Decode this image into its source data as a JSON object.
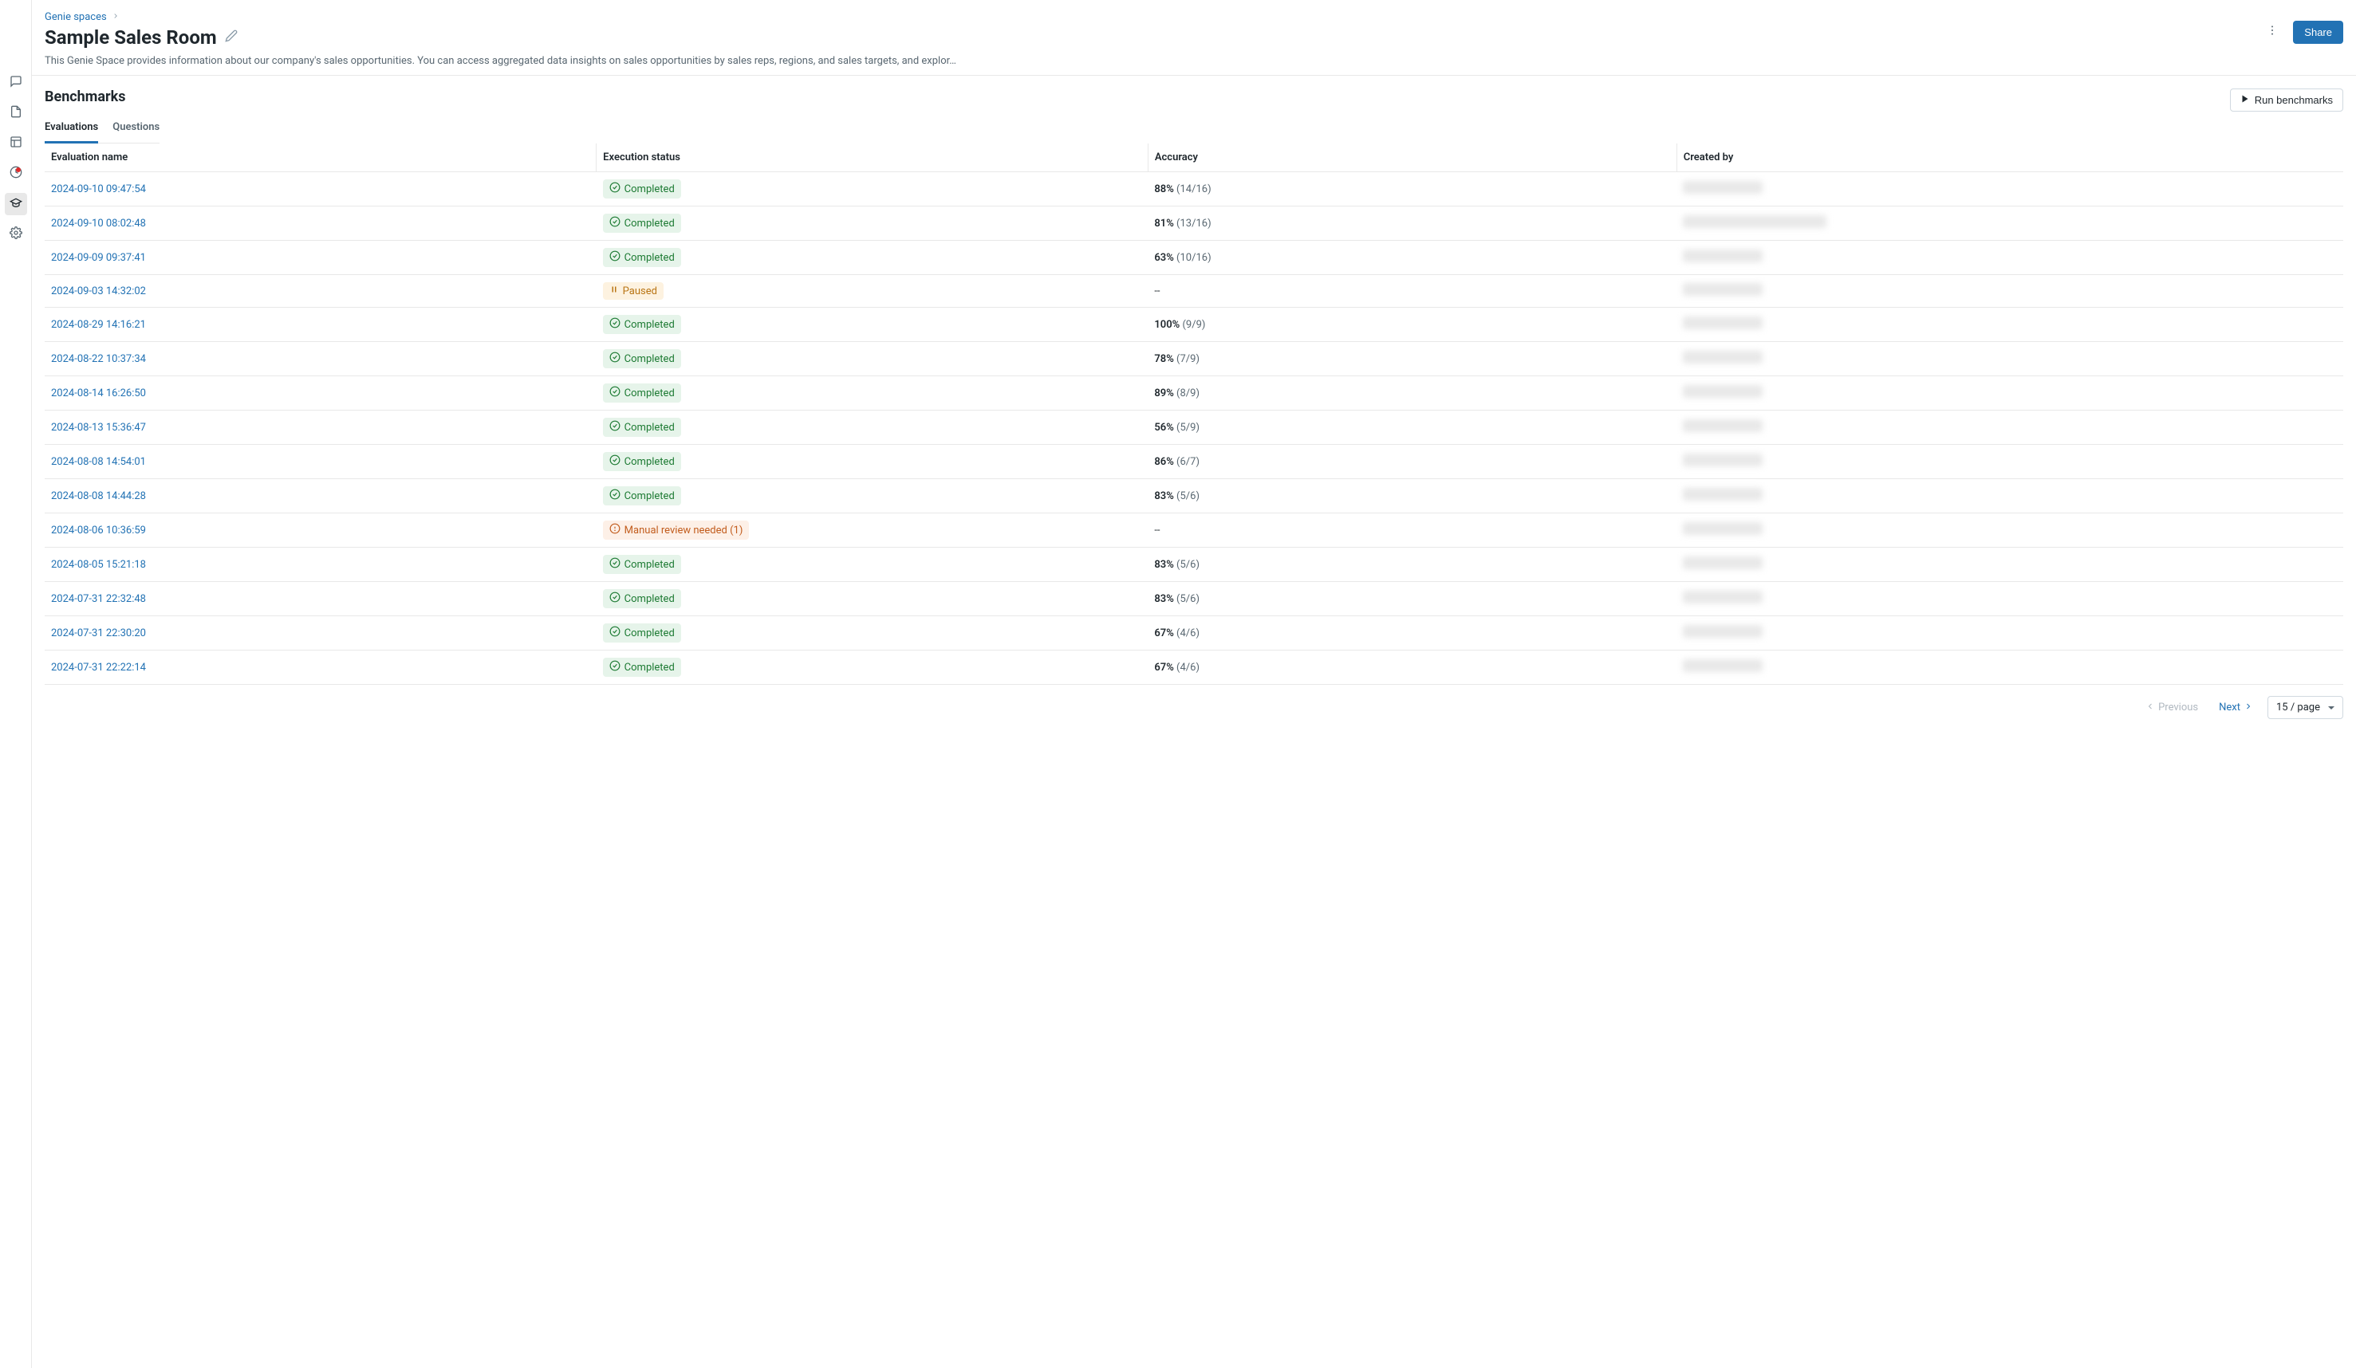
{
  "breadcrumb": {
    "root": "Genie spaces"
  },
  "page": {
    "title": "Sample Sales Room",
    "description": "This Genie Space provides information about our company's sales opportunities. You can access aggregated data insights on sales opportunities by sales reps, regions, and sales targets, and explor…"
  },
  "actions": {
    "share": "Share",
    "run_benchmarks": "Run benchmarks"
  },
  "section": {
    "title": "Benchmarks"
  },
  "tabs": {
    "evaluations": "Evaluations",
    "questions": "Questions",
    "active": "evaluations"
  },
  "table": {
    "columns": {
      "name": "Evaluation name",
      "status": "Execution status",
      "accuracy": "Accuracy",
      "created_by": "Created by"
    },
    "rows": [
      {
        "name": "2024-09-10 09:47:54",
        "status": "completed",
        "status_label": "Completed",
        "accuracy_pct": "88%",
        "accuracy_frac": "(14/16)",
        "wide": false
      },
      {
        "name": "2024-09-10 08:02:48",
        "status": "completed",
        "status_label": "Completed",
        "accuracy_pct": "81%",
        "accuracy_frac": "(13/16)",
        "wide": true
      },
      {
        "name": "2024-09-09 09:37:41",
        "status": "completed",
        "status_label": "Completed",
        "accuracy_pct": "63%",
        "accuracy_frac": "(10/16)",
        "wide": false
      },
      {
        "name": "2024-09-03 14:32:02",
        "status": "paused",
        "status_label": "Paused",
        "accuracy_pct": "--",
        "accuracy_frac": "",
        "wide": false
      },
      {
        "name": "2024-08-29 14:16:21",
        "status": "completed",
        "status_label": "Completed",
        "accuracy_pct": "100%",
        "accuracy_frac": "(9/9)",
        "wide": false
      },
      {
        "name": "2024-08-22 10:37:34",
        "status": "completed",
        "status_label": "Completed",
        "accuracy_pct": "78%",
        "accuracy_frac": "(7/9)",
        "wide": false
      },
      {
        "name": "2024-08-14 16:26:50",
        "status": "completed",
        "status_label": "Completed",
        "accuracy_pct": "89%",
        "accuracy_frac": "(8/9)",
        "wide": false
      },
      {
        "name": "2024-08-13 15:36:47",
        "status": "completed",
        "status_label": "Completed",
        "accuracy_pct": "56%",
        "accuracy_frac": "(5/9)",
        "wide": false
      },
      {
        "name": "2024-08-08 14:54:01",
        "status": "completed",
        "status_label": "Completed",
        "accuracy_pct": "86%",
        "accuracy_frac": "(6/7)",
        "wide": false
      },
      {
        "name": "2024-08-08 14:44:28",
        "status": "completed",
        "status_label": "Completed",
        "accuracy_pct": "83%",
        "accuracy_frac": "(5/6)",
        "wide": false
      },
      {
        "name": "2024-08-06 10:36:59",
        "status": "review",
        "status_label": "Manual review needed (1)",
        "accuracy_pct": "--",
        "accuracy_frac": "",
        "wide": false
      },
      {
        "name": "2024-08-05 15:21:18",
        "status": "completed",
        "status_label": "Completed",
        "accuracy_pct": "83%",
        "accuracy_frac": "(5/6)",
        "wide": false
      },
      {
        "name": "2024-07-31 22:32:48",
        "status": "completed",
        "status_label": "Completed",
        "accuracy_pct": "83%",
        "accuracy_frac": "(5/6)",
        "wide": false
      },
      {
        "name": "2024-07-31 22:30:20",
        "status": "completed",
        "status_label": "Completed",
        "accuracy_pct": "67%",
        "accuracy_frac": "(4/6)",
        "wide": false
      },
      {
        "name": "2024-07-31 22:22:14",
        "status": "completed",
        "status_label": "Completed",
        "accuracy_pct": "67%",
        "accuracy_frac": "(4/6)",
        "wide": false
      }
    ]
  },
  "pagination": {
    "previous": "Previous",
    "next": "Next",
    "page_size": "15 / page"
  }
}
